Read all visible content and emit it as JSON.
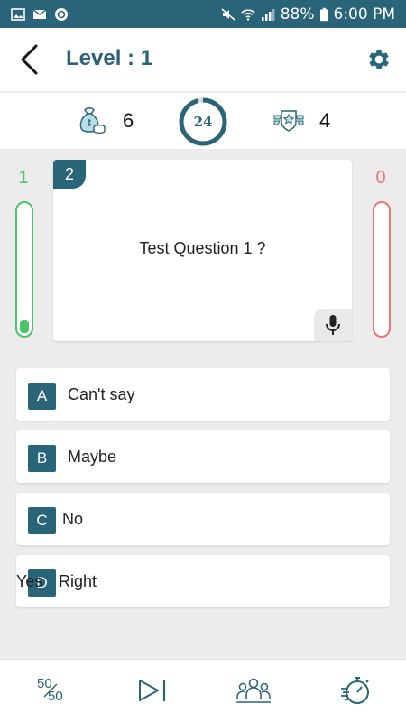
{
  "status_bar": {
    "battery": "88%",
    "time": "6:00 PM",
    "icons": [
      "image-icon",
      "mail-icon",
      "sync-icon",
      "mute-icon",
      "wifi-icon",
      "signal-icon",
      "battery-icon"
    ]
  },
  "header": {
    "title": "Level : 1",
    "back_icon": "back-arrow-icon",
    "settings_icon": "gear-icon"
  },
  "stats": {
    "coins": "6",
    "timer": "24",
    "timer_progress": 0.96,
    "rank": "4"
  },
  "scores": {
    "correct": "1",
    "wrong": "0",
    "correct_fill": 0.1,
    "wrong_fill": 0
  },
  "question": {
    "number": "2",
    "text": "Test Question 1 ?"
  },
  "options": [
    {
      "letter": "A",
      "text": "Can't say"
    },
    {
      "letter": "B",
      "text": "Maybe"
    },
    {
      "letter": "C",
      "text": "No"
    },
    {
      "letter": "D",
      "prefix": "Yes",
      "text": "Right"
    }
  ],
  "toolbar": {
    "fifty_top": "50",
    "fifty_bottom": "50",
    "items": [
      "fifty-fifty-icon",
      "skip-icon",
      "audience-poll-icon",
      "timer-freeze-icon"
    ]
  },
  "colors": {
    "primary": "#2a6478",
    "correct": "#4cc36a",
    "wrong": "#e8776f"
  }
}
